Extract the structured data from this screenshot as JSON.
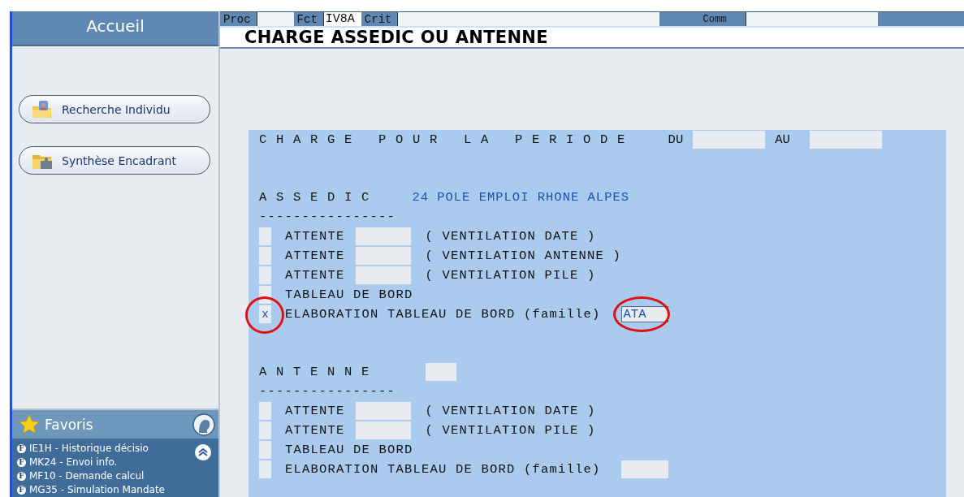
{
  "sidebar": {
    "title": "Accueil",
    "buttons": [
      {
        "label": "Recherche Individu",
        "kind": "person-folder"
      },
      {
        "label": "Synthèse Encadrant",
        "kind": "puzzle-folder"
      }
    ],
    "favorites": {
      "title": "Favoris",
      "items": [
        {
          "badge": "F",
          "label": "IE1H - Historique décisio"
        },
        {
          "badge": "F",
          "label": "MK24 - Envoi info."
        },
        {
          "badge": "F",
          "label": "MF10 - Demande calcul"
        },
        {
          "badge": "F",
          "label": "MG35 - Simulation Mandate"
        }
      ]
    }
  },
  "toolbar": {
    "fields": [
      {
        "label": "Proc"
      },
      {
        "label": "Fct",
        "value": "IV8A"
      },
      {
        "label": "Crit",
        "wide": true
      }
    ],
    "comm": {
      "label": "Comm"
    }
  },
  "page_title": "CHARGE ASSEDIC OU ANTENNE",
  "period": {
    "label": "C H A R G E   P O U R   L A   P E R I O D E",
    "from_label": "DU",
    "to_label": "AU"
  },
  "sections": [
    {
      "title": "A S S E D I C",
      "code": "24",
      "name": "POLE EMPLOI RHONE ALPES",
      "rule": "----------------",
      "rows": [
        {
          "kind": "attente",
          "label": "ATTENTE",
          "note": "( VENTILATION DATE )"
        },
        {
          "kind": "attente",
          "label": "ATTENTE",
          "note": "( VENTILATION ANTENNE )"
        },
        {
          "kind": "attente",
          "label": "ATTENTE",
          "note": "( VENTILATION PILE )"
        },
        {
          "kind": "plain",
          "label": "TABLEAU DE BORD"
        },
        {
          "kind": "famille",
          "label": "ELABORATION TABLEAU DE BORD (famille)",
          "check": "x",
          "check_circled": true,
          "value": "ATA",
          "field_circled": true
        }
      ]
    },
    {
      "title": "A N T E N N E",
      "has_field": true,
      "rule": "----------------",
      "rows": [
        {
          "kind": "attente",
          "label": "ATTENTE",
          "note": "( VENTILATION DATE )"
        },
        {
          "kind": "attente",
          "label": "ATTENTE",
          "note": "( VENTILATION PILE )"
        },
        {
          "kind": "plain",
          "label": "TABLEAU DE BORD"
        },
        {
          "kind": "famille",
          "label": "ELABORATION TABLEAU DE BORD (famille)"
        }
      ]
    }
  ]
}
